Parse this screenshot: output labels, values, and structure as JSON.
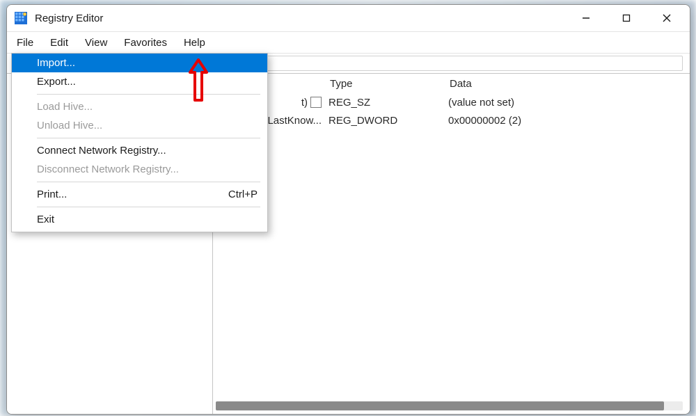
{
  "title": "Registry Editor",
  "menubar": [
    "File",
    "Edit",
    "View",
    "Favorites",
    "Help"
  ],
  "file_menu": {
    "import": "Import...",
    "export": "Export...",
    "load_hive": "Load Hive...",
    "unload_hive": "Unload Hive...",
    "connect": "Connect Network Registry...",
    "disconnect": "Disconnect Network Registry...",
    "print": "Print...",
    "print_accel": "Ctrl+P",
    "exit": "Exit"
  },
  "columns": {
    "type": "Type",
    "data": "Data"
  },
  "rows": [
    {
      "name_tail": "t)",
      "type": "REG_SZ",
      "data": "(value not set)"
    },
    {
      "name_tail": "LastKnow...",
      "type": "REG_DWORD",
      "data": "0x00000002 (2)"
    }
  ],
  "icons": {
    "app": "registry-editor-icon"
  }
}
